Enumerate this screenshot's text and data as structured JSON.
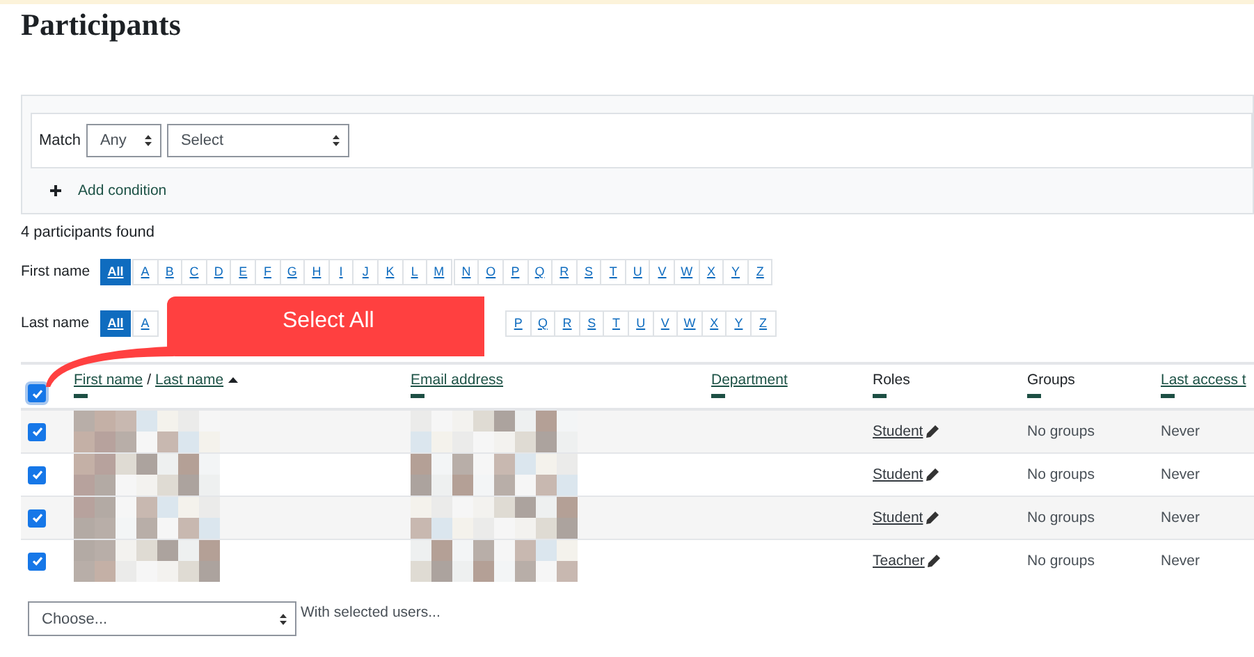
{
  "page": {
    "title": "Participants"
  },
  "filter": {
    "match_label": "Match",
    "match_value": "Any",
    "condition_value": "Select",
    "add_condition": "Add condition"
  },
  "result_count": "4 participants found",
  "initials_bars": [
    {
      "label": "First name",
      "groups": [
        [
          {
            "text": "All",
            "selected": true
          }
        ],
        [
          {
            "text": "A",
            "selected": false
          },
          {
            "text": "B",
            "selected": false
          },
          {
            "text": "C",
            "selected": false
          },
          {
            "text": "D",
            "selected": false
          },
          {
            "text": "E",
            "selected": false
          },
          {
            "text": "F",
            "selected": false
          },
          {
            "text": "G",
            "selected": false
          },
          {
            "text": "H",
            "selected": false
          },
          {
            "text": "I",
            "selected": false
          },
          {
            "text": "J",
            "selected": false
          },
          {
            "text": "K",
            "selected": false
          },
          {
            "text": "L",
            "selected": false
          },
          {
            "text": "M",
            "selected": false
          }
        ],
        [
          {
            "text": "N",
            "selected": false
          },
          {
            "text": "O",
            "selected": false
          },
          {
            "text": "P",
            "selected": false
          },
          {
            "text": "Q",
            "selected": false
          },
          {
            "text": "R",
            "selected": false
          },
          {
            "text": "S",
            "selected": false
          },
          {
            "text": "T",
            "selected": false
          },
          {
            "text": "U",
            "selected": false
          },
          {
            "text": "V",
            "selected": false
          },
          {
            "text": "W",
            "selected": false
          },
          {
            "text": "X",
            "selected": false
          },
          {
            "text": "Y",
            "selected": false
          },
          {
            "text": "Z",
            "selected": false
          }
        ]
      ]
    },
    {
      "label": "Last name",
      "groups": [
        [
          {
            "text": "All",
            "selected": true
          }
        ],
        [
          {
            "text": "A",
            "selected": false
          }
        ],
        [
          {
            "text": "P",
            "selected": false
          },
          {
            "text": "Q",
            "selected": false
          },
          {
            "text": "R",
            "selected": false
          },
          {
            "text": "S",
            "selected": false
          },
          {
            "text": "T",
            "selected": false
          },
          {
            "text": "U",
            "selected": false
          },
          {
            "text": "V",
            "selected": false
          },
          {
            "text": "W",
            "selected": false
          },
          {
            "text": "X",
            "selected": false
          },
          {
            "text": "Y",
            "selected": false
          },
          {
            "text": "Z",
            "selected": false
          }
        ]
      ]
    }
  ],
  "callout": {
    "text": "Select All"
  },
  "table": {
    "select_all": {
      "checked": true
    },
    "columns": [
      {
        "kind": "name",
        "first": "First name",
        "separator": "/",
        "last": "Last name",
        "sorted_ascending": true
      },
      {
        "kind": "link",
        "label": "Email address"
      },
      {
        "kind": "link",
        "label": "Department"
      },
      {
        "kind": "plain",
        "label": "Roles"
      },
      {
        "kind": "plain",
        "label": "Groups"
      },
      {
        "kind": "link",
        "label": "Last access t"
      }
    ],
    "rows": [
      {
        "checked": true,
        "role": "Student",
        "groups": "No groups",
        "last_access": "Never"
      },
      {
        "checked": true,
        "role": "Student",
        "groups": "No groups",
        "last_access": "Never"
      },
      {
        "checked": true,
        "role": "Student",
        "groups": "No groups",
        "last_access": "Never"
      },
      {
        "checked": true,
        "role": "Teacher",
        "groups": "No groups",
        "last_access": "Never"
      }
    ]
  },
  "bulk": {
    "value": "Choose...",
    "label": "With selected users..."
  }
}
